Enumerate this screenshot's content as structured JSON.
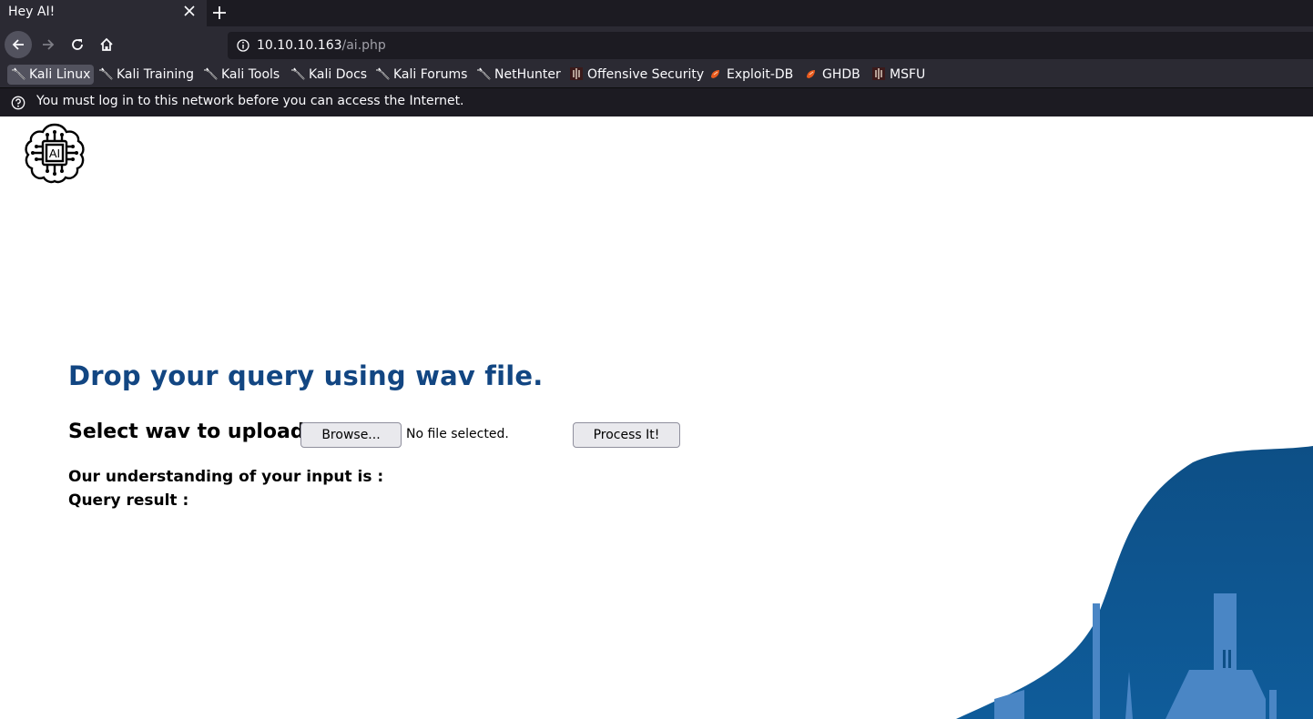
{
  "browser": {
    "tab": {
      "title": "Hey AI!"
    },
    "url": {
      "host": "10.10.10.163",
      "path": "/ai.php"
    },
    "bookmarks": [
      {
        "label": "Kali Linux",
        "icon": "kali-dragon-icon"
      },
      {
        "label": "Kali Training",
        "icon": "kali-dragon-icon"
      },
      {
        "label": "Kali Tools",
        "icon": "kali-dragon-icon"
      },
      {
        "label": "Kali Docs",
        "icon": "kali-dragon-icon"
      },
      {
        "label": "Kali Forums",
        "icon": "kali-dragon-icon"
      },
      {
        "label": "NetHunter",
        "icon": "kali-dragon-icon"
      },
      {
        "label": "Offensive Security",
        "icon": "offsec-icon"
      },
      {
        "label": "Exploit-DB",
        "icon": "exploitdb-icon"
      },
      {
        "label": "GHDB",
        "icon": "exploitdb-icon"
      },
      {
        "label": "MSFU",
        "icon": "offsec-icon"
      }
    ],
    "notice": "You must log in to this network before you can access the Internet."
  },
  "page": {
    "heading": "Drop your query using wav file.",
    "upload_label": "Select wav to upload:",
    "browse_label": "Browse...",
    "file_status": "No file selected.",
    "process_label": "Process It!",
    "understanding_label": "Our understanding of your input is :",
    "query_result_label": "Query result :",
    "logo_text": "AI"
  },
  "colors": {
    "heading": "#124682",
    "wave_dark": "#0f5791",
    "wave_light": "#4a86c5",
    "browser_dark": "#1c1b22",
    "browser_mid": "#2b2a33"
  }
}
